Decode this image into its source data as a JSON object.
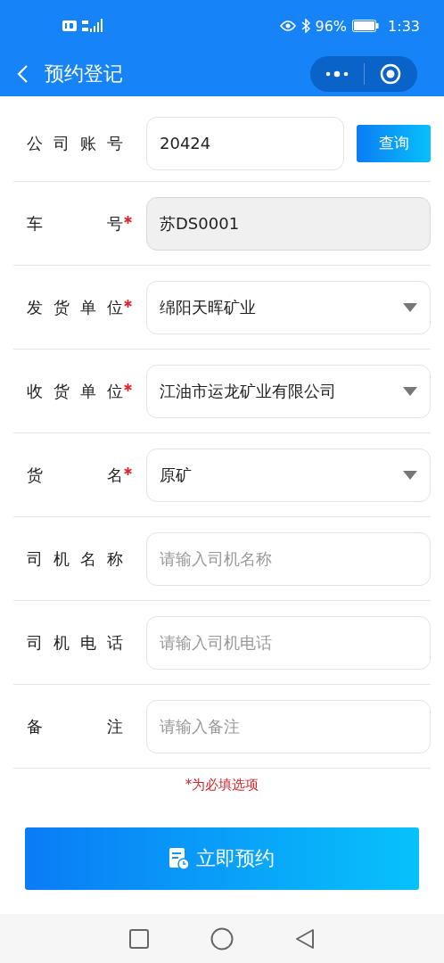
{
  "status_bar": {
    "battery": "96%",
    "time": "1:33"
  },
  "nav": {
    "title": "预约登记"
  },
  "form": {
    "rows": [
      {
        "label": "公司账号",
        "required": false,
        "kind": "input",
        "value": "20424",
        "disabled": false,
        "button": "查询"
      },
      {
        "label": "车号",
        "required": true,
        "kind": "input",
        "value": "苏DS0001",
        "disabled": true
      },
      {
        "label": "发货单位",
        "required": true,
        "kind": "select",
        "value": "绵阳天晖矿业"
      },
      {
        "label": "收货单位",
        "required": true,
        "kind": "select",
        "value": "江油市运龙矿业有限公司"
      },
      {
        "label": "货名",
        "required": true,
        "kind": "select",
        "value": "原矿"
      },
      {
        "label": "司机名称",
        "required": false,
        "kind": "input",
        "placeholder": "请输入司机名称",
        "disabled": false
      },
      {
        "label": "司机电话",
        "required": false,
        "kind": "input",
        "placeholder": "请输入司机电话",
        "disabled": false
      },
      {
        "label": "备注",
        "required": false,
        "kind": "input",
        "placeholder": "请输入备注",
        "disabled": false
      }
    ],
    "required_note": "*为必填选项",
    "submit": "立即预约"
  }
}
